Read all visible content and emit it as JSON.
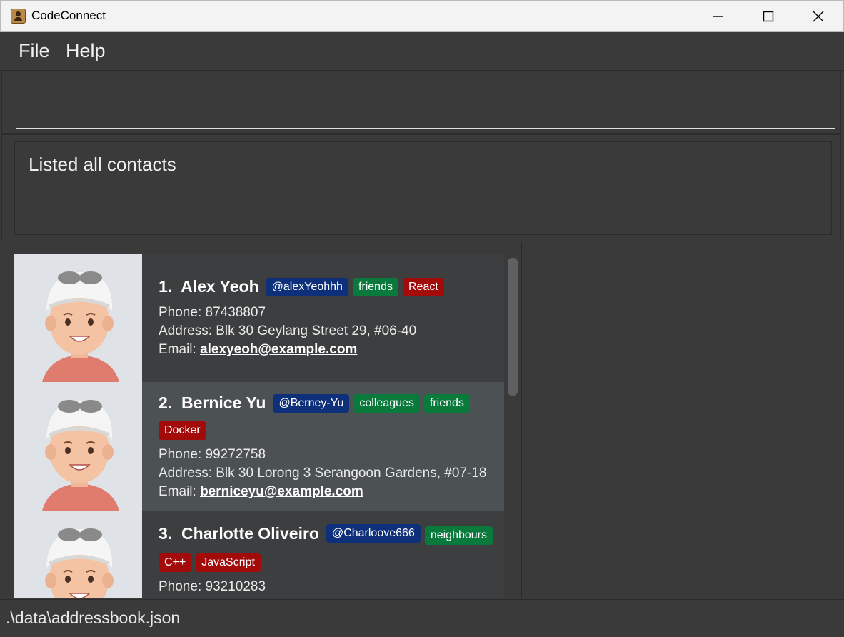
{
  "window": {
    "title": "CodeConnect"
  },
  "menu": {
    "file": "File",
    "help": "Help"
  },
  "command": {
    "value": ""
  },
  "result": {
    "text": "Listed all contacts"
  },
  "persons": [
    {
      "index": "1.",
      "name": "Alex Yeoh",
      "handle": "@alexYeohhh",
      "tags": [
        {
          "label": "friends",
          "color": "#0a7a3c"
        },
        {
          "label": "React",
          "color": "#a30b0b"
        }
      ],
      "phone": "Phone: 87438807",
      "address": "Address: Blk 30 Geylang Street 29, #06-40",
      "email_label": "Email: ",
      "email": "alexyeoh@example.com"
    },
    {
      "index": "2.",
      "name": "Bernice Yu",
      "handle": "@Berney-Yu",
      "tags": [
        {
          "label": "colleagues",
          "color": "#0a7a3c"
        },
        {
          "label": "friends",
          "color": "#0a7a3c"
        },
        {
          "label": "Docker",
          "color": "#a30b0b"
        }
      ],
      "phone": "Phone: 99272758",
      "address": "Address: Blk 30 Lorong 3 Serangoon Gardens, #07-18",
      "email_label": "Email: ",
      "email": "berniceyu@example.com"
    },
    {
      "index": "3.",
      "name": "Charlotte Oliveiro",
      "handle": "@Charloove666",
      "tags": [
        {
          "label": "neighbours",
          "color": "#0a7a3c"
        },
        {
          "label": "C++",
          "color": "#a30b0b"
        },
        {
          "label": "JavaScript",
          "color": "#a30b0b"
        }
      ],
      "phone": "Phone: 93210283"
    }
  ],
  "status": {
    "path": ".\\data\\addressbook.json"
  }
}
